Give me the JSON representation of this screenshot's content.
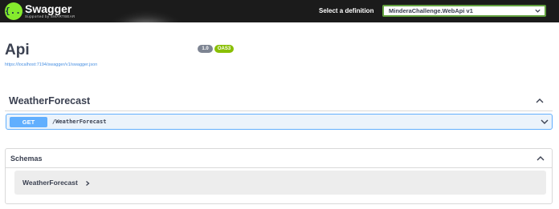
{
  "topbar": {
    "brand": "Swagger",
    "brand_subtitle": "Supported by SMARTBEAR",
    "logo_glyph": "{...}",
    "select_label": "Select a definition",
    "definition_selected": "MinderaChallenge.WebApi v1"
  },
  "info": {
    "title": "Api",
    "version_badge": "1.0",
    "oas_badge": "OAS3",
    "spec_url": "https://localhost:7194/swagger/v1/swagger.json"
  },
  "tag": {
    "name": "WeatherForecast",
    "operations": [
      {
        "method": "GET",
        "path": "/WeatherForecast"
      }
    ]
  },
  "schemas": {
    "title": "Schemas",
    "models": [
      {
        "name": "WeatherForecast"
      }
    ]
  },
  "colors": {
    "topbar_bg": "#1b1b1b",
    "logo_green": "#85ea2d",
    "get_blue": "#61affe",
    "get_bg": "#ebf3fb",
    "oas_green": "#89bf04",
    "version_gray": "#7d8492",
    "link_blue": "#4990e2",
    "text_dark": "#3b4151"
  },
  "icons": {
    "logo": "swagger-logo-icon",
    "select_caret": "chevron-down-icon",
    "tag_toggle": "chevron-up-icon",
    "op_toggle": "chevron-down-icon",
    "schemas_toggle": "chevron-up-icon",
    "model_expand": "chevron-right-icon"
  }
}
